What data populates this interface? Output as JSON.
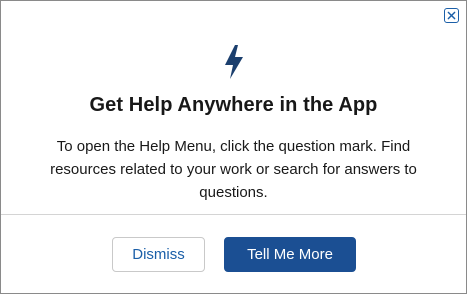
{
  "dialog": {
    "title": "Get Help Anywhere in the App",
    "body": "To open the Help Menu, click the question mark. Find resources related to your work or search for answers to questions.",
    "icon": "lightning-bolt-icon",
    "close_icon": "close-icon",
    "buttons": {
      "dismiss_label": "Dismiss",
      "more_label": "Tell Me More"
    },
    "colors": {
      "accent": "#1b4f93",
      "link": "#1b5fa8",
      "text": "#181818"
    }
  }
}
